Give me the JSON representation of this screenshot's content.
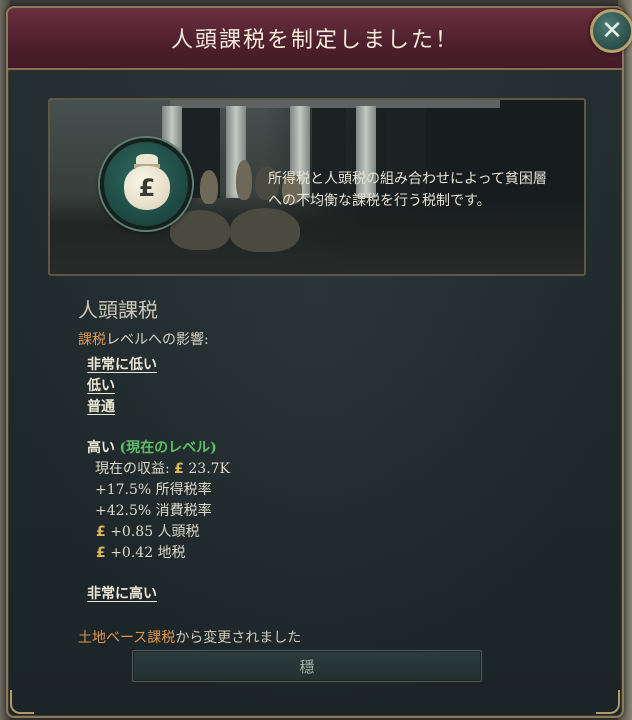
{
  "dialog": {
    "title": "人頭課税を制定しました！",
    "close_icon": "close-icon",
    "close_glyph": "✕"
  },
  "scene": {
    "icon": "money-bag-pound-icon",
    "icon_glyph": "£",
    "description": "所得税と人頭税の組み合わせによって貧困層への不均衡な課税を行う税制です。"
  },
  "law": {
    "name": "人頭課税",
    "impact_keyword": "課税",
    "impact_rest": "レベルへの影響:",
    "levels_upper": [
      "非常に低い",
      "低い",
      "普通"
    ],
    "current": {
      "level": "高い",
      "current_label": "(現在のレベル)",
      "revenue_label": "現在の収益:",
      "revenue_value": "23.7K",
      "income_tax": "+17.5% 所得税率",
      "consumption_tax": "+42.5% 消費税率",
      "poll_tax": "+0.85 人頭税",
      "land_tax": "+0.42 地税"
    },
    "levels_lower": [
      "非常に高い"
    ],
    "changed_keyword": "土地ベース課税",
    "changed_rest": "から変更されました"
  },
  "footer": {
    "confirm_label": "穩"
  },
  "colors": {
    "title_bar": "#4e1f2d",
    "keyword": "#e0944c",
    "current": "#5fbf68",
    "gold": "#e1b84f",
    "panel": "#1f292b"
  }
}
